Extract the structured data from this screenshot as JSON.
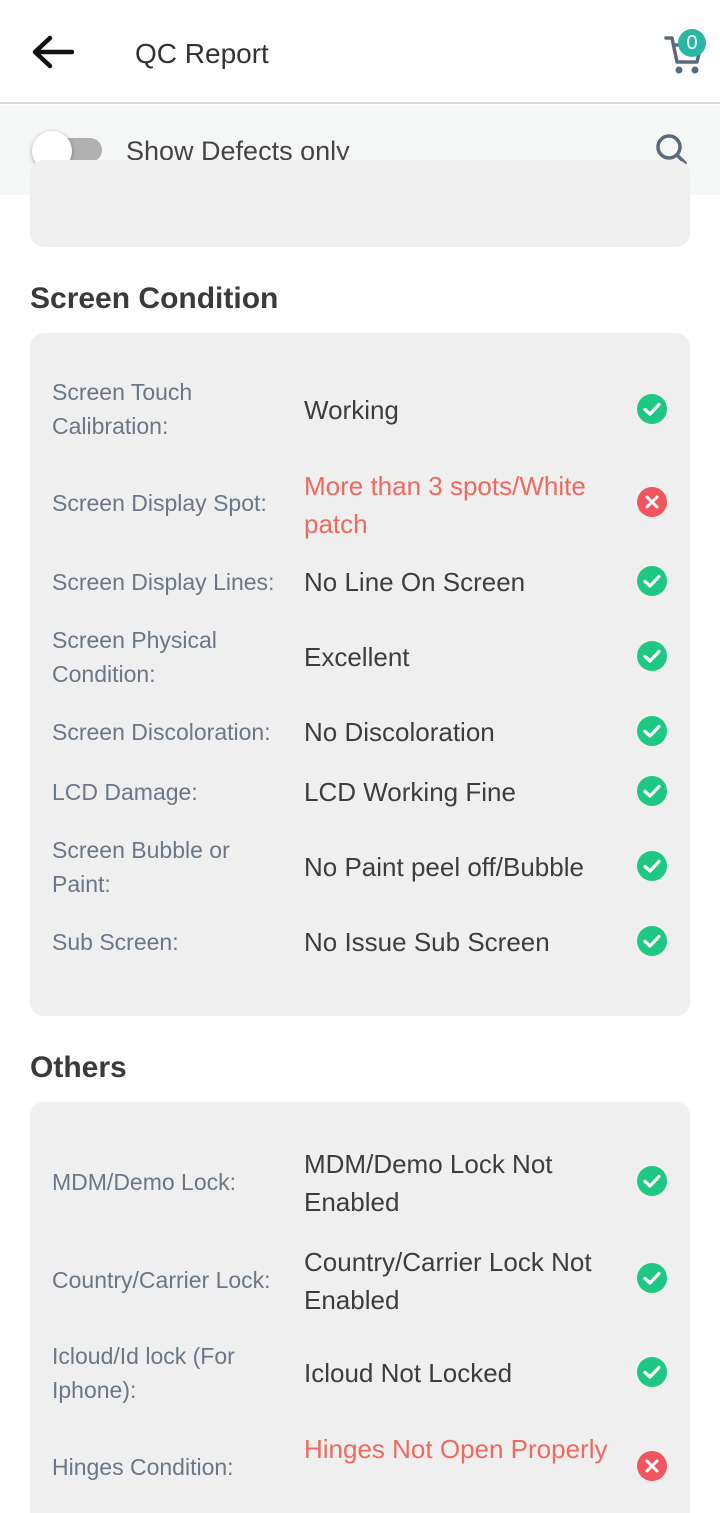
{
  "header": {
    "title": "QC Report",
    "cart_count": "0"
  },
  "filter": {
    "label": "Show Defects only",
    "enabled": false
  },
  "colors": {
    "ok": "#1ec882",
    "defect": "#f0565d",
    "defect_text": "#ee6a5f",
    "accent": "#2bb5a5"
  },
  "sections": [
    {
      "title": "Screen Condition",
      "rows": [
        {
          "label": "Screen Touch Calibration:",
          "value": "Working",
          "status": "ok"
        },
        {
          "label": "Screen Display Spot:",
          "value": "More than 3 spots/White patch",
          "status": "defect"
        },
        {
          "label": "Screen Display Lines:",
          "value": "No Line On Screen",
          "status": "ok"
        },
        {
          "label": "Screen Physical Condition:",
          "value": "Excellent",
          "status": "ok"
        },
        {
          "label": "Screen Discoloration:",
          "value": "No Discoloration",
          "status": "ok"
        },
        {
          "label": "LCD Damage:",
          "value": "LCD Working Fine",
          "status": "ok"
        },
        {
          "label": "Screen Bubble or Paint:",
          "value": "No Paint peel off/Bubble",
          "status": "ok"
        },
        {
          "label": "Sub Screen:",
          "value": "No Issue Sub Screen",
          "status": "ok"
        }
      ]
    },
    {
      "title": "Others",
      "rows": [
        {
          "label": "MDM/Demo Lock:",
          "value": "MDM/Demo Lock Not Enabled",
          "status": "ok"
        },
        {
          "label": "Country/Carrier Lock:",
          "value": "Country/Carrier Lock Not Enabled",
          "status": "ok"
        },
        {
          "label": "Icloud/Id lock (For Iphone):",
          "value": "Icloud Not Locked",
          "status": "ok"
        },
        {
          "label": "Hinges Condition:",
          "value": "Hinges Not Open Properly",
          "status": "defect"
        }
      ]
    }
  ]
}
